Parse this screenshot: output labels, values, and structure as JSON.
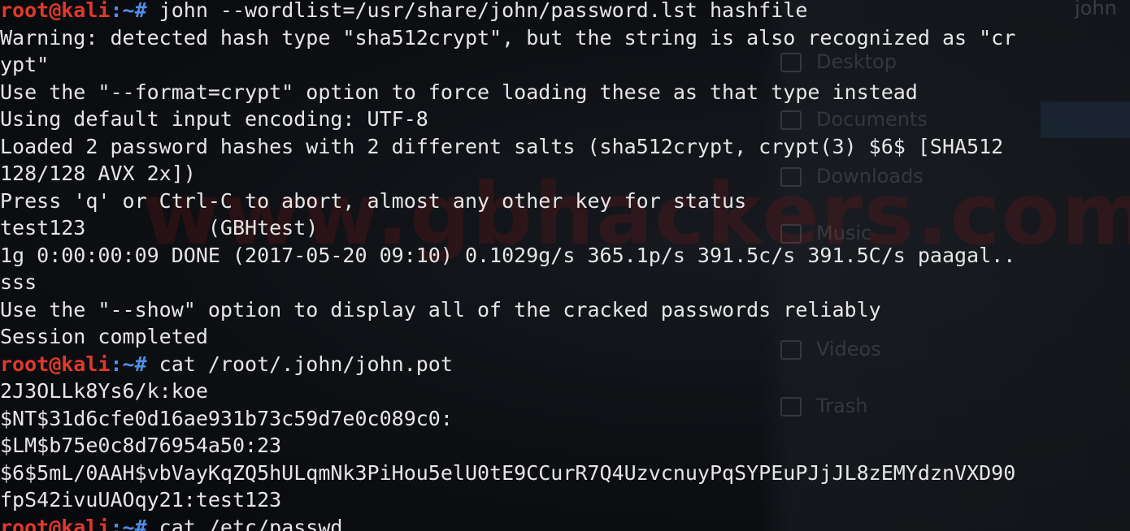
{
  "prompt": {
    "user_host": "root@kali",
    "path": ":~#"
  },
  "background_window": {
    "title": "john",
    "items": [
      "Desktop",
      "Documents",
      "Downloads",
      "Music",
      "Videos",
      "Trash"
    ]
  },
  "watermark": "www.gbhackers.com",
  "output": [
    {
      "type": "prompt",
      "command": " john --wordlist=/usr/share/john/password.lst hashfile"
    },
    {
      "type": "text",
      "text": "Warning: detected hash type \"sha512crypt\", but the string is also recognized as \"cr"
    },
    {
      "type": "text",
      "text": "ypt\""
    },
    {
      "type": "text",
      "text": "Use the \"--format=crypt\" option to force loading these as that type instead"
    },
    {
      "type": "text",
      "text": "Using default input encoding: UTF-8"
    },
    {
      "type": "text",
      "text": "Loaded 2 password hashes with 2 different salts (sha512crypt, crypt(3) $6$ [SHA512 "
    },
    {
      "type": "text",
      "text": "128/128 AVX 2x])"
    },
    {
      "type": "text",
      "text": "Press 'q' or Ctrl-C to abort, almost any other key for status"
    },
    {
      "type": "text",
      "text": "test123          (GBHtest)"
    },
    {
      "type": "text",
      "text": "1g 0:00:00:09 DONE (2017-05-20 09:10) 0.1029g/s 365.1p/s 391.5c/s 391.5C/s paagal.."
    },
    {
      "type": "text",
      "text": "sss"
    },
    {
      "type": "text",
      "text": "Use the \"--show\" option to display all of the cracked passwords reliably"
    },
    {
      "type": "text",
      "text": "Session completed"
    },
    {
      "type": "prompt",
      "command": " cat /root/.john/john.pot"
    },
    {
      "type": "text",
      "text": "2J3OLLk8Ys6/k:koe"
    },
    {
      "type": "text",
      "text": "$NT$31d6cfe0d16ae931b73c59d7e0c089c0:"
    },
    {
      "type": "text",
      "text": "$LM$b75e0c8d76954a50:23"
    },
    {
      "type": "text",
      "text": "$6$5mL/0AAH$vbVayKqZQ5hULqmNk3PiHou5elU0tE9CCurR7Q4UzvcnuyPqSYPEuPJjJL8zEMYdznVXD90"
    },
    {
      "type": "text",
      "text": "fpS42ivuUAOqy21:test123"
    },
    {
      "type": "prompt",
      "command": " cat /etc/passwd"
    }
  ]
}
